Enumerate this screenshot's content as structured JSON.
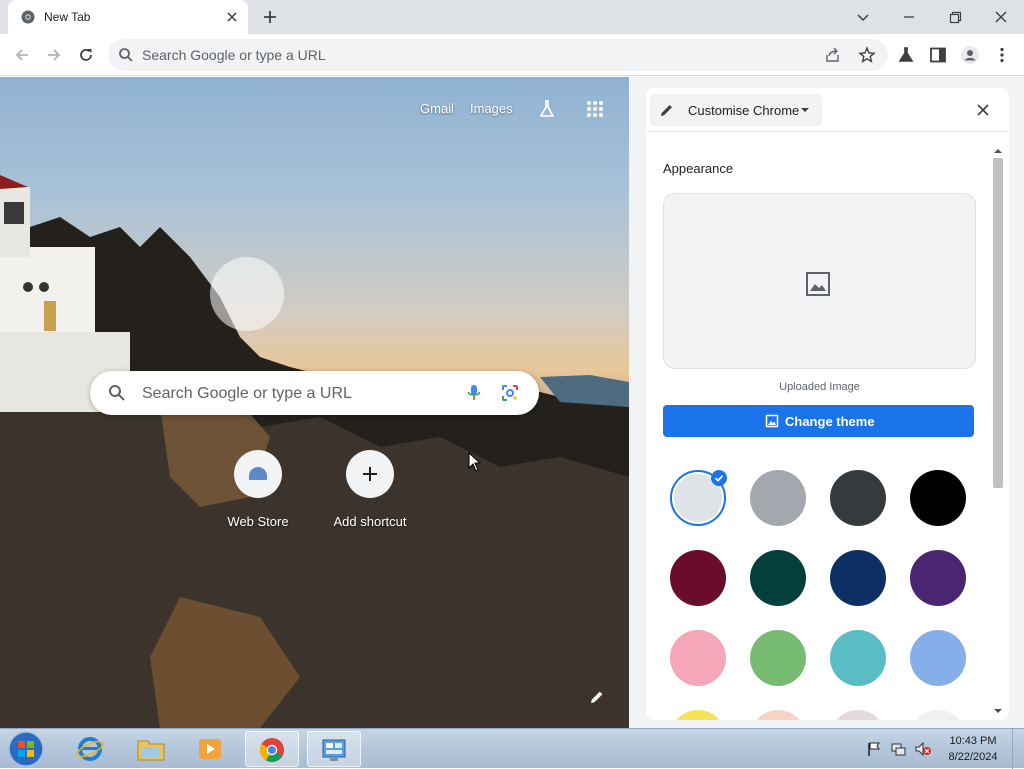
{
  "browser": {
    "tab": {
      "title": "New Tab"
    },
    "omnibox": {
      "placeholder": "Search Google or type a URL"
    }
  },
  "ntp": {
    "links": {
      "gmail": "Gmail",
      "images": "Images"
    },
    "search": {
      "placeholder": "Search Google or type a URL"
    },
    "shortcuts": [
      {
        "label": "Web Store"
      },
      {
        "label": "Add shortcut"
      }
    ]
  },
  "panel": {
    "select_label": "Customise Chrome",
    "appearance_heading": "Appearance",
    "uploaded_caption": "Uploaded Image",
    "change_theme_label": "Change theme",
    "swatches": [
      {
        "color": "#dfe3e8",
        "selected": true
      },
      {
        "color": "#a4a7ae"
      },
      {
        "color": "#353a3f"
      },
      {
        "color": "#000000"
      },
      {
        "color": "#6a0c2c"
      },
      {
        "color": "#033f3b"
      },
      {
        "color": "#0d2f63"
      },
      {
        "color": "#4a2572"
      },
      {
        "color": "#f5a6b8"
      },
      {
        "color": "#77bb72"
      },
      {
        "color": "#59bec3"
      },
      {
        "color": "#86aee9"
      },
      {
        "color": "#f7e257"
      },
      {
        "color": "#f8d3c3"
      },
      {
        "color": "#e2dadd"
      },
      {
        "color": "#f0f0f0"
      }
    ]
  },
  "taskbar": {
    "time": "10:43 PM",
    "date": "8/22/2024"
  },
  "colors": {
    "accent": "#1a73e8",
    "tabstrip": "#dee1e6"
  }
}
